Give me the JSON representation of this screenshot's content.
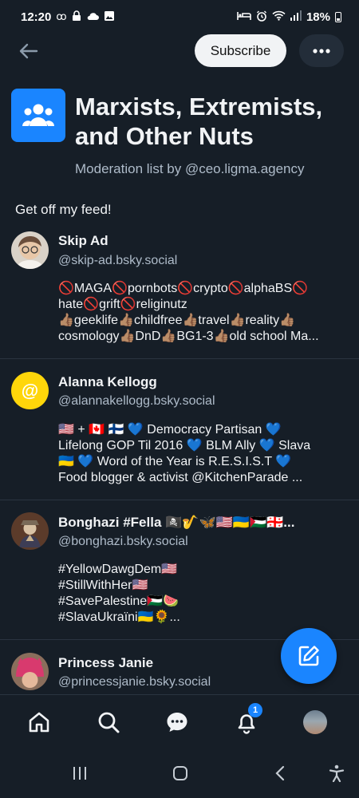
{
  "status_bar": {
    "time": "12:20",
    "battery": "18%"
  },
  "topbar": {
    "subscribe_label": "Subscribe"
  },
  "list": {
    "title": "Marxists, Extremists, and Other Nuts",
    "subtitle": "Moderation list by @ceo.ligma.agency",
    "description": "Get off my feed!"
  },
  "entries": [
    {
      "name": "Skip Ad",
      "handle": "@skip-ad.bsky.social",
      "bio": "🚫MAGA🚫pornbots🚫crypto🚫alphaBS🚫\nhate🚫grift🚫religinutz\n👍🏽geeklife👍🏽childfree👍🏽travel👍🏽reality👍🏽\ncosmology👍🏽DnD👍🏽BG1-3👍🏽old school Ma..."
    },
    {
      "name": "Alanna Kellogg",
      "handle": "@alannakellogg.bsky.social",
      "avatar_glyph": "@",
      "bio": "🇺🇸 + 🇨🇦 🇫🇮 💙 Democracy Partisan 💙\nLifelong GOP Til 2016 💙 BLM Ally 💙 Slava\n🇺🇦 💙 Word of the Year is R.E.S.I.S.T 💙\nFood blogger & activist @KitchenParade ..."
    },
    {
      "name": "Bonghazi #Fella 🏴‍☠️🎷🦋🇺🇸🇺🇦🇵🇸🇬🇪...",
      "handle": "@bonghazi.bsky.social",
      "bio": "#YellowDawgDem🇺🇸\n#StillWithHer🇺🇸\n#SavePalestine🇵🇸🍉\n#SlavaUkraïni🇺🇦🌻..."
    },
    {
      "name": "Princess Janie",
      "handle": "@princessjanie.bsky.social",
      "bio": ""
    }
  ],
  "bottom_nav": {
    "notification_count": "1"
  },
  "colors": {
    "background": "#161e27",
    "accent": "#1a85ff",
    "muted_text": "#aebbc9"
  }
}
